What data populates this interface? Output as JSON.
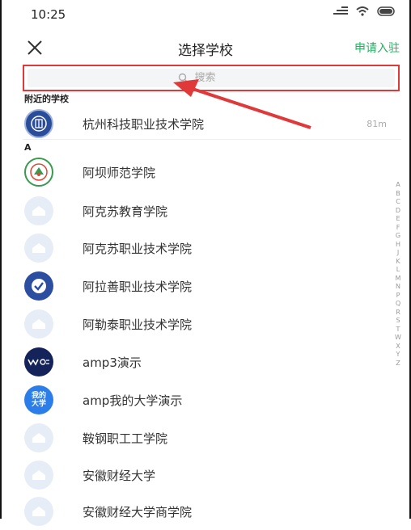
{
  "status": {
    "time": "10:25"
  },
  "nav": {
    "title": "选择学校",
    "apply": "申请入驻"
  },
  "search": {
    "placeholder": "搜索"
  },
  "nearby": {
    "header": "附近的学校",
    "school": {
      "name": "杭州科技职业技术学院",
      "distance": "81m"
    }
  },
  "group_a": {
    "header": "A",
    "schools": [
      {
        "name": "阿坝师范学院",
        "logo": "abat-logo",
        "color": "#ffffff"
      },
      {
        "name": "阿克苏教育学院",
        "logo": "placeholder",
        "color": "#e6edf6"
      },
      {
        "name": "阿克苏职业技术学院",
        "logo": "placeholder",
        "color": "#e6edf6"
      },
      {
        "name": "阿拉善职业技术学院",
        "logo": "check-logo",
        "color": "#2b4ea0"
      },
      {
        "name": "阿勒泰职业技术学院",
        "logo": "placeholder",
        "color": "#e6edf6"
      },
      {
        "name": "amp3演示",
        "logo": "we-logo",
        "color": "#14235a"
      },
      {
        "name": "amp我的大学演示",
        "logo": "mu-logo",
        "color": "#2b7de9",
        "text": "我的大学"
      },
      {
        "name": "鞍钢职工工学院",
        "logo": "placeholder",
        "color": "#e6edf6"
      },
      {
        "name": "安徽财经大学",
        "logo": "placeholder",
        "color": "#e6edf6"
      },
      {
        "name": "安徽财经大学商学院",
        "logo": "placeholder",
        "color": "#e6edf6"
      }
    ]
  },
  "index_letters": [
    "A",
    "B",
    "C",
    "D",
    "E",
    "F",
    "G",
    "H",
    "J",
    "K",
    "L",
    "M",
    "N",
    "P",
    "Q",
    "R",
    "S",
    "T",
    "W",
    "X",
    "Y",
    "Z"
  ]
}
